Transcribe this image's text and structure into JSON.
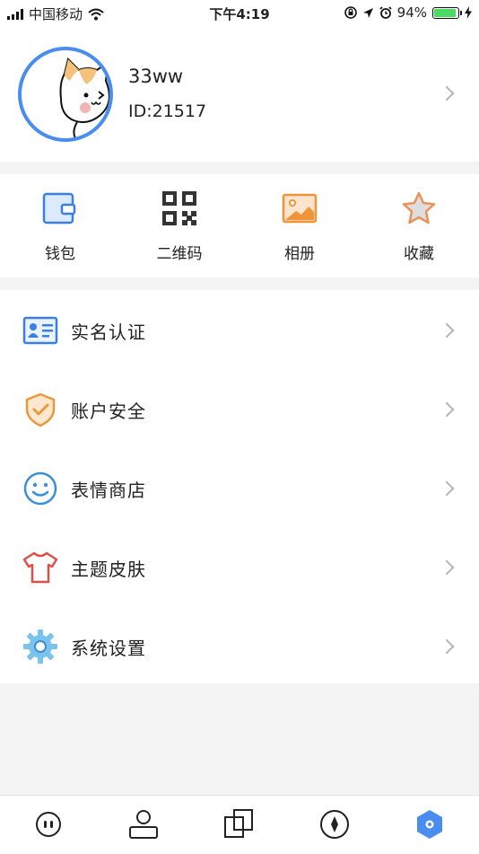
{
  "status_bar": {
    "carrier": "中国移动",
    "time": "下午4:19",
    "battery_percent": "94%",
    "battery_level": 0.94
  },
  "profile": {
    "username": "33ww",
    "user_id": "ID:21517"
  },
  "quick_actions": [
    {
      "label": "钱包",
      "icon": "wallet-icon"
    },
    {
      "label": "二维码",
      "icon": "qr-code-icon"
    },
    {
      "label": "相册",
      "icon": "photo-album-icon"
    },
    {
      "label": "收藏",
      "icon": "star-icon"
    }
  ],
  "menu": [
    {
      "label": "实名认证",
      "icon": "id-card-icon"
    },
    {
      "label": "账户安全",
      "icon": "shield-check-icon"
    },
    {
      "label": "表情商店",
      "icon": "smiley-icon"
    },
    {
      "label": "主题皮肤",
      "icon": "tshirt-icon"
    },
    {
      "label": "系统设置",
      "icon": "gear-icon"
    }
  ],
  "tabs": [
    {
      "icon": "chat-icon",
      "active": false
    },
    {
      "icon": "contacts-icon",
      "active": false
    },
    {
      "icon": "squares-icon",
      "active": false
    },
    {
      "icon": "discover-compass-icon",
      "active": false
    },
    {
      "icon": "me-hexagon-icon",
      "active": true
    }
  ],
  "colors": {
    "accent": "#4a8df0",
    "background": "#f4f4f4",
    "orange": "#f0943a",
    "red": "#e24f45"
  }
}
